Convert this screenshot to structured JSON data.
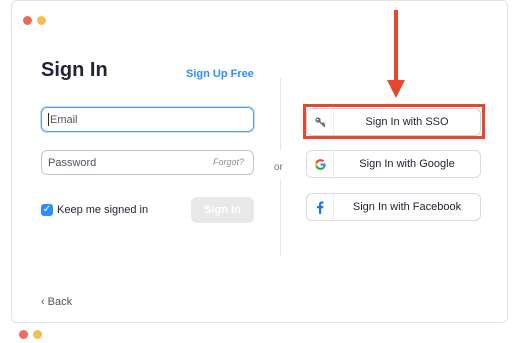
{
  "window": {
    "traffic_lights": [
      "red",
      "yellow"
    ]
  },
  "signin": {
    "title": "Sign In",
    "signup_link": "Sign Up Free",
    "email_placeholder": "Email",
    "password_placeholder": "Password",
    "forgot_label": "Forgot?",
    "remember_label": "Keep me signed in",
    "remember_checked": true,
    "submit_label": "Sign In"
  },
  "divider": {
    "label": "or"
  },
  "sso_options": [
    {
      "label": "Sign In with SSO",
      "icon": "key-icon"
    },
    {
      "label": "Sign In with Google",
      "icon": "google-icon"
    },
    {
      "label": "Sign In with Facebook",
      "icon": "facebook-icon"
    }
  ],
  "footer": {
    "back_label": "Back"
  },
  "annotation": {
    "color": "#e6472d",
    "target": "Sign In with SSO"
  },
  "colors": {
    "accent": "#2d8cff",
    "annotation": "#e6472d",
    "disabled_button": "#e8e8eb"
  }
}
